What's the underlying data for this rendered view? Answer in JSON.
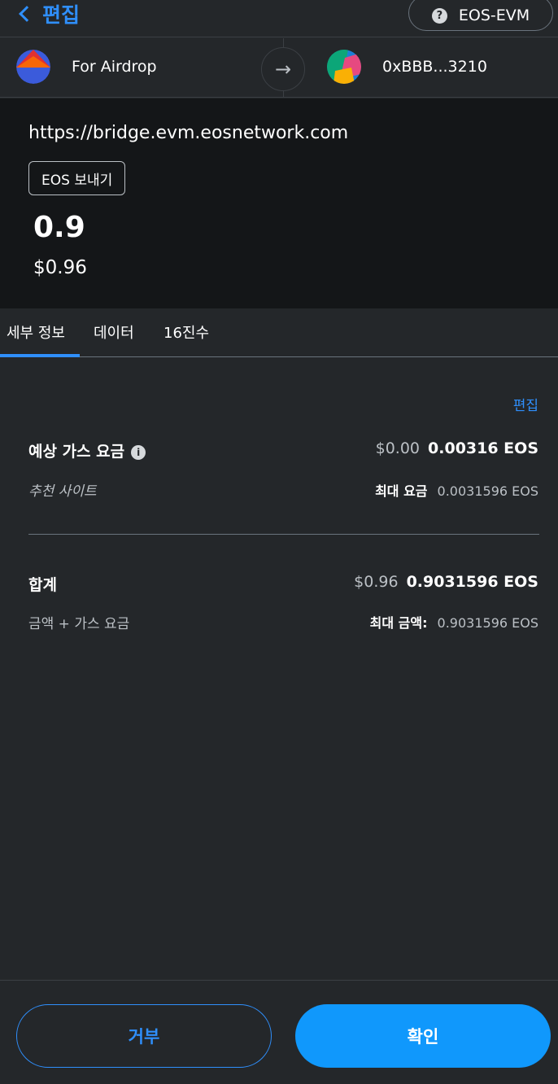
{
  "header": {
    "back_label": "편집",
    "network_name": "EOS-EVM",
    "help_symbol": "?"
  },
  "accounts": {
    "from_name": "For Airdrop",
    "to_address": "0xBBB...3210",
    "arrow_symbol": "→"
  },
  "summary": {
    "origin": "https://bridge.evm.eosnetwork.com",
    "action_label": "EOS 보내기",
    "amount": "0.9",
    "fiat": "$0.96"
  },
  "tabs": [
    {
      "label": "세부 정보",
      "active": true
    },
    {
      "label": "데이터",
      "active": false
    },
    {
      "label": "16진수",
      "active": false
    }
  ],
  "details": {
    "edit_label": "편집",
    "gas": {
      "label": "예상 가스 요금",
      "info_symbol": "i",
      "fiat": "$0.00",
      "amount": "0.00316 EOS",
      "sub_label": "추천 사이트",
      "max_label": "최대 요금",
      "max_value": "0.0031596 EOS"
    },
    "total": {
      "label": "합계",
      "fiat": "$0.96",
      "amount": "0.9031596 EOS",
      "sub_label": "금액 + 가스 요금",
      "max_label": "최대 금액:",
      "max_value": "0.9031596 EOS"
    }
  },
  "footer": {
    "reject_label": "거부",
    "confirm_label": "확인"
  },
  "colors": {
    "accent": "#2f8ffc",
    "confirm_bg": "#1098fc",
    "background": "#24272a",
    "summary_bg": "#141618"
  }
}
